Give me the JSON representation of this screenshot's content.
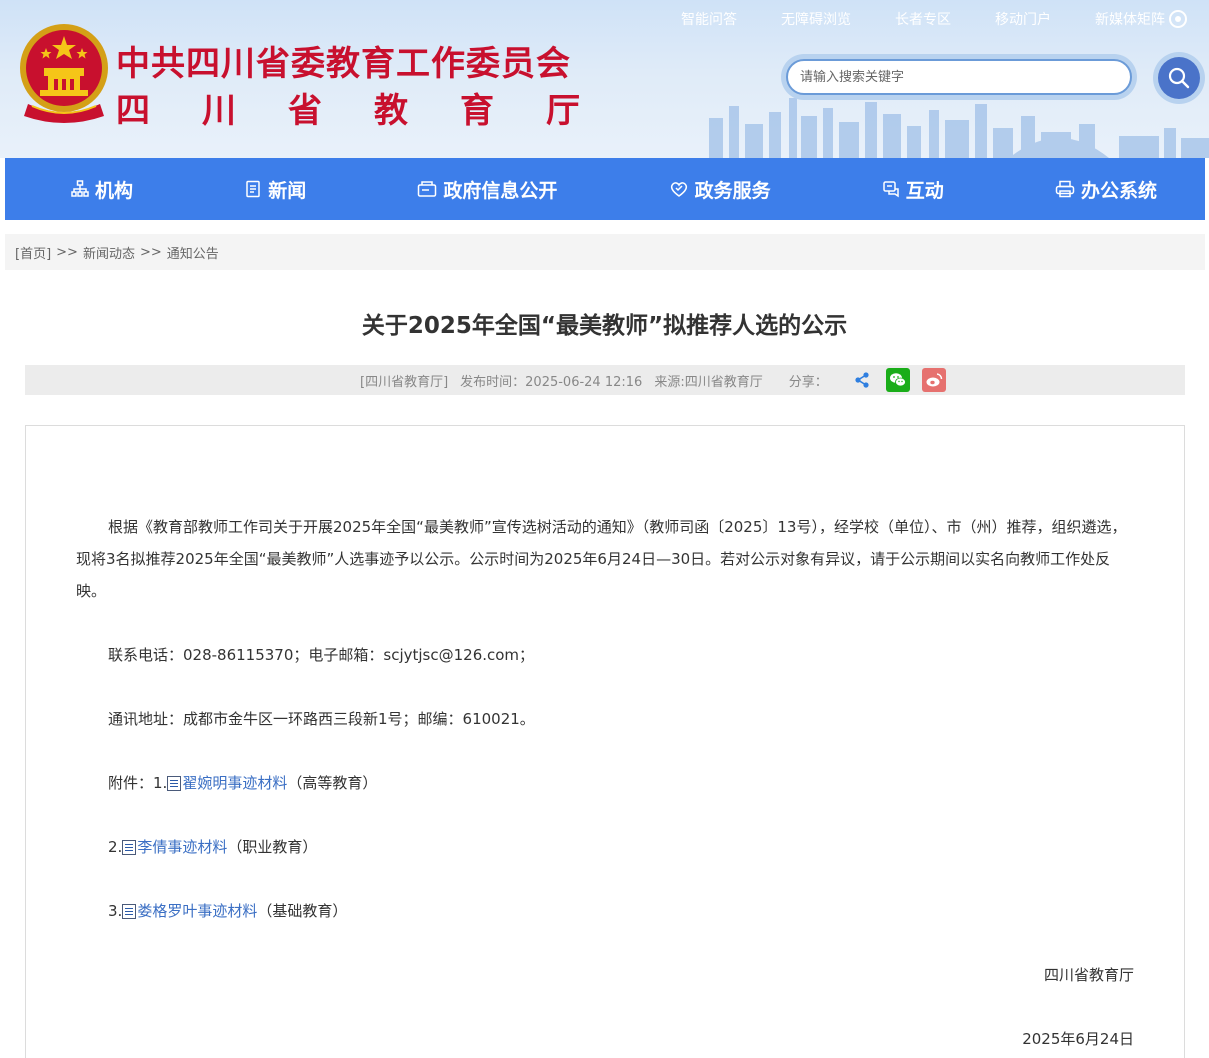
{
  "header": {
    "title_line1": "中共四川省委教育工作委员会",
    "title_line2": "四川省教育厅",
    "top_links": [
      "智能问答",
      "无障碍浏览",
      "长者专区",
      "移动门户",
      "新媒体矩阵"
    ],
    "search_placeholder": "请输入搜索关键字",
    "accent_color": "#c8102e"
  },
  "nav": {
    "color": "#3d7eea",
    "items": [
      {
        "label": "机构",
        "icon": "org-chart-icon"
      },
      {
        "label": "新闻",
        "icon": "news-icon"
      },
      {
        "label": "政府信息公开",
        "icon": "info-open-icon"
      },
      {
        "label": "政务服务",
        "icon": "service-heart-icon"
      },
      {
        "label": "互动",
        "icon": "chat-icon"
      },
      {
        "label": "办公系统",
        "icon": "printer-icon"
      }
    ]
  },
  "breadcrumb": [
    "[首页]",
    "新闻动态",
    "通知公告"
  ],
  "breadcrumb_sep": ">>",
  "article": {
    "title": "关于2025年全国“最美教师”拟推荐人选的公示",
    "meta_org": "[四川省教育厅]",
    "meta_time": "发布时间：2025-06-24 12:16",
    "meta_source": "来源:四川省教育厅",
    "share_label": "分享：",
    "para1": "根据《教育部教师工作司关于开展2025年全国“最美教师”宣传选树活动的通知》（教师司函〔2025〕13号），经学校（单位）、市（州）推荐，组织遴选，现将3名拟推荐2025年全国“最美教师”人选事迹予以公示。公示时间为2025年6月24日—30日。若对公示对象有异议，请于公示期间以实名向教师工作处反映。",
    "contact": "联系电话：028-86115370；电子邮箱：scjytjsc@126.com；",
    "address": "通讯地址：成都市金牛区一环路西三段新1号；邮编：610021。",
    "attachments": [
      {
        "prefix": "附件：1.",
        "link": "翟婉明事迹材料",
        "suffix": "（高等教育）"
      },
      {
        "prefix": "2.",
        "link": "李倩事迹材料",
        "suffix": "（职业教育）"
      },
      {
        "prefix": "3.",
        "link": "娄格罗叶事迹材料",
        "suffix": "（基础教育）"
      }
    ],
    "signature": "四川省教育厅",
    "date": "2025年6月24日"
  }
}
